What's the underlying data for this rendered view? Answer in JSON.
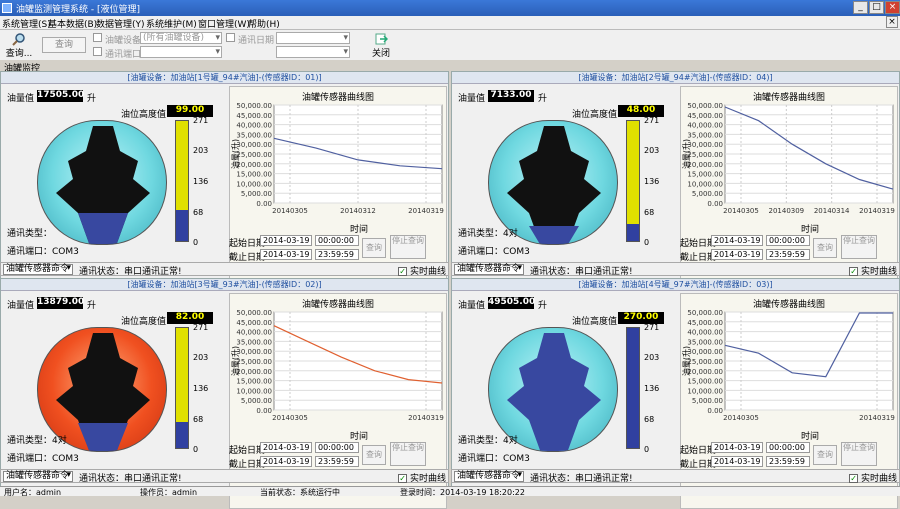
{
  "window": {
    "title": "油罐监测管理系统 - [液位管理]",
    "buttons": [
      "_",
      "□",
      "×"
    ]
  },
  "menu": [
    "系统管理(S)",
    "基本数据(B)",
    "数据管理(Y)",
    "系统维护(M)",
    "窗口管理(W)",
    "帮助(H)"
  ],
  "toolbar": {
    "query_label": "查询...",
    "query_btn": "查询",
    "chk_tank_device": "油罐设备",
    "chk_comm_port": "通讯端口",
    "device_select": "(所有油罐设备)",
    "chk_comm_time": "通讯日期",
    "close_label": "关闭"
  },
  "section_title": "油罐监控",
  "common": {
    "oil_value_label": "油量值",
    "unit": "升",
    "level_label": "油位高度值",
    "comm_type": "通讯类型：",
    "comm_port": "通讯端口：",
    "comm_type_val": "4对",
    "comm_port_val": "COM3",
    "start_date": "起始日期",
    "end_date": "截止日期",
    "query_btn": "查询",
    "stop_btn": "停止查询",
    "cmd_combo": "油罐传感器命令",
    "realtime_chk": "实时曲线",
    "chart_title": "油罐传感器曲线图",
    "x_label": "时间",
    "y_label": "油量(升)",
    "scale_ticks": [
      "271",
      "203",
      "136",
      "68",
      "0"
    ]
  },
  "panels": [
    {
      "header": "[油罐设备：加油站[1号罐_94#汽油]-(传感器ID：01)]",
      "oil_value": "17505.00",
      "level": "99.00",
      "start": "2014-03-19",
      "start_time": "00:00:00",
      "end": "2014-03-19",
      "end_time": "23:59:59",
      "status": "通讯状态：串口通讯正常!",
      "x_ticks": [
        "20140305",
        "20140312",
        "20140319"
      ]
    },
    {
      "header": "[油罐设备：加油站[2号罐_94#汽油]-(传感器ID：04)]",
      "oil_value": "7133.00",
      "level": "48.00",
      "start": "2014-03-19",
      "start_time": "00:00:00",
      "end": "2014-03-19",
      "end_time": "23:59:59",
      "status": "通讯状态：串口通讯正常!",
      "x_ticks": [
        "20140305",
        "20140309",
        "20140314",
        "20140319"
      ]
    },
    {
      "header": "[油罐设备：加油站[3号罐_93#汽油]-(传感器ID：02)]",
      "oil_value": "13879.00",
      "level": "82.00",
      "start": "2014-03-19",
      "start_time": "00:00:00",
      "end": "2014-03-19",
      "end_time": "23:59:59",
      "status": "通讯状态：串口通讯正常!",
      "x_ticks": [
        "20140305",
        "20140319"
      ]
    },
    {
      "header": "[油罐设备：加油站[4号罐_97#汽油]-(传感器ID：03)]",
      "oil_value": "49505.00",
      "level": "270.00",
      "start": "2014-03-19",
      "start_time": "00:00:00",
      "end": "2014-03-19",
      "end_time": "23:59:59",
      "status": "通讯状态：串口通讯正常!",
      "x_ticks": [
        "20140305",
        "20140319"
      ]
    }
  ],
  "chart_data": [
    {
      "type": "line",
      "title": "油罐传感器曲线图",
      "xlabel": "时间",
      "ylabel": "油量(升)",
      "ylim": [
        0,
        50000
      ],
      "y_ticks": [
        0,
        5000,
        10000,
        15000,
        20000,
        25000,
        30000,
        35000,
        40000,
        45000,
        50000
      ],
      "x": [
        "20140305",
        "20140312",
        "20140319"
      ],
      "series": [
        {
          "color": "#5060a0",
          "values": [
            33000,
            28000,
            22000,
            19000,
            17500
          ]
        }
      ]
    },
    {
      "type": "line",
      "title": "油罐传感器曲线图",
      "xlabel": "时间",
      "ylabel": "油量(升)",
      "ylim": [
        0,
        50000
      ],
      "y_ticks": [
        0,
        5000,
        10000,
        15000,
        20000,
        25000,
        30000,
        35000,
        40000,
        45000,
        50000
      ],
      "x": [
        "20140305",
        "20140309",
        "20140314",
        "20140319"
      ],
      "series": [
        {
          "color": "#5060a0",
          "values": [
            49000,
            42000,
            30000,
            20000,
            12000,
            7100
          ]
        }
      ]
    },
    {
      "type": "line",
      "title": "油罐传感器曲线图",
      "xlabel": "时间",
      "ylabel": "油量(升)",
      "ylim": [
        0,
        50000
      ],
      "y_ticks": [
        0,
        5000,
        10000,
        15000,
        20000,
        25000,
        30000,
        35000,
        40000,
        45000,
        50000
      ],
      "x": [
        "20140305",
        "20140319"
      ],
      "series": [
        {
          "color": "#e06030",
          "values": [
            43000,
            35000,
            27000,
            20000,
            15500,
            13800
          ]
        }
      ]
    },
    {
      "type": "line",
      "title": "油罐传感器曲线图",
      "xlabel": "时间",
      "ylabel": "油量(升)",
      "ylim": [
        0,
        50000
      ],
      "y_ticks": [
        0,
        5000,
        10000,
        15000,
        20000,
        25000,
        30000,
        35000,
        40000,
        45000,
        50000
      ],
      "x": [
        "20140305",
        "20140319"
      ],
      "series": [
        {
          "color": "#5060a0",
          "values": [
            33000,
            29000,
            19000,
            17000,
            49500,
            49500
          ]
        }
      ]
    }
  ],
  "statusbar": [
    "用户名：admin",
    "操作员：admin",
    "当前状态：系统运行中",
    "登录时间：2014-03-19 18:20:22"
  ]
}
